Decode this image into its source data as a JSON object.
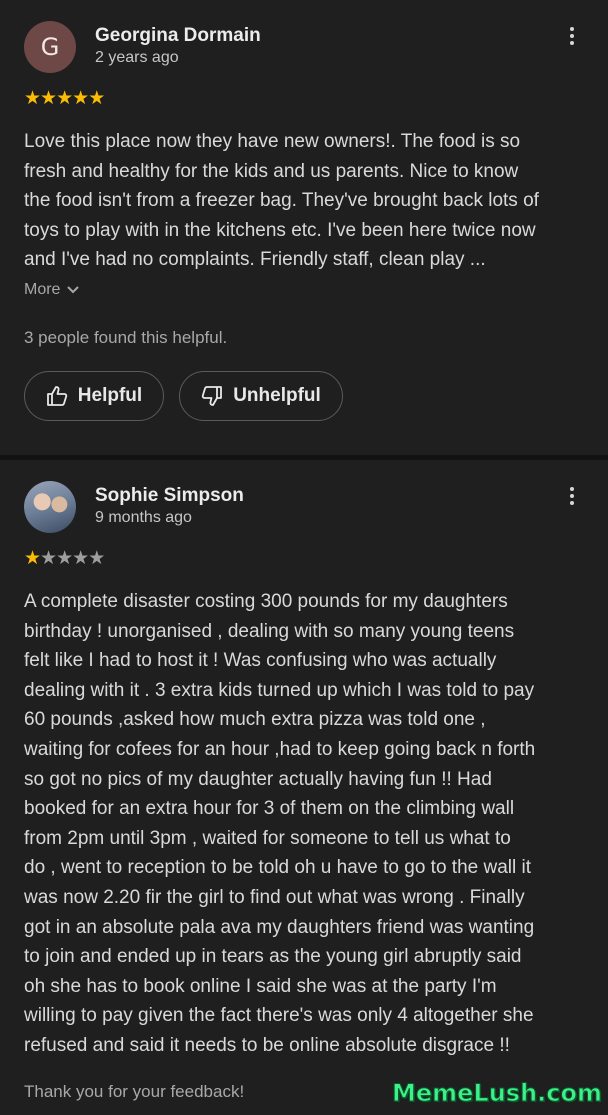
{
  "reviews": [
    {
      "avatar_letter": "G",
      "name": "Georgina Dormain",
      "time": "2 years ago",
      "rating": 5,
      "text": "Love this place now they have new owners!. The food is so\nfresh and healthy for the kids and us parents. Nice to know\nthe food isn't from a freezer bag. They've brought back lots of\ntoys to play with in the kitchens etc. I've been here twice now\nand I've had no complaints. Friendly staff, clean play ...",
      "more_label": "More",
      "helpful_count": "3 people found this helpful.",
      "helpful_label": "Helpful",
      "unhelpful_label": "Unhelpful"
    },
    {
      "name": "Sophie Simpson",
      "time": "9 months ago",
      "rating": 1,
      "text": "A complete disaster costing 300 pounds for my daughters\nbirthday ! unorganised , dealing with so many young teens\nfelt like I had to host it ! Was confusing who was actually\ndealing with it . 3 extra kids turned up which I was told to pay\n60 pounds ,asked how much extra pizza was told one ,\nwaiting for cofees for an hour ,had to keep going back n forth\nso got no pics of my daughter actually having fun !! Had\nbooked for an extra hour for 3 of them on the climbing wall\nfrom 2pm until 3pm , waited for someone to tell us what to\ndo , went to reception to be told oh u have to go to the wall it\nwas now 2.20 fir the girl to find out what was wrong . Finally\ngot in an absolute pala ava my daughters friend was wanting\nto join and ended up in tears as the young girl abruptly said\noh she has to book online I said she was at the party I'm\nwilling to pay given the fact there's was only 4 altogether she\nrefused and said it needs to be online  absolute disgrace !!",
      "owner_response_preview": "Thank you for your feedback!"
    }
  ],
  "watermark": "MemeLush.com",
  "colors": {
    "background": "#1f1f1f",
    "divider": "#121212",
    "star_on": "#fbbc04",
    "star_off": "#9e9e9e",
    "avatar_bg": "#6e4846",
    "watermark": "#3df08a"
  }
}
